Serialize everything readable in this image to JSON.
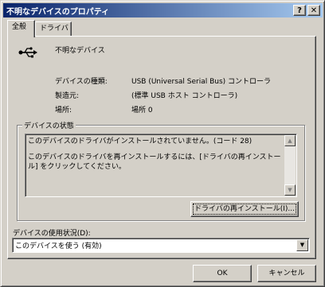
{
  "window": {
    "title": "不明なデバイスのプロパティ",
    "help_button": "?",
    "close_button": "✕"
  },
  "tabs": [
    {
      "label": "全般",
      "active": true
    },
    {
      "label": "ドライバ",
      "active": false
    }
  ],
  "device": {
    "icon": "usb-icon",
    "name": "不明なデバイス"
  },
  "properties": [
    {
      "label": "デバイスの種類:",
      "value": "USB (Universal Serial Bus) コントローラ"
    },
    {
      "label": "製造元:",
      "value": "(標準 USB ホスト コントローラ)"
    },
    {
      "label": "場所:",
      "value": "場所 0"
    }
  ],
  "status": {
    "group_title": "デバイスの状態",
    "line1": "このデバイスのドライバがインストールされていません。(コード 28)",
    "line2": "このデバイスのドライバを再インストールするには、[ドライバの再インストール] をクリックしてください。"
  },
  "reinstall_button": "ドライバの再インストール(I)...",
  "usage": {
    "label": "デバイスの使用状況(D):",
    "selected": "このデバイスを使う (有効)"
  },
  "footer": {
    "ok": "OK",
    "cancel": "キャンセル"
  }
}
